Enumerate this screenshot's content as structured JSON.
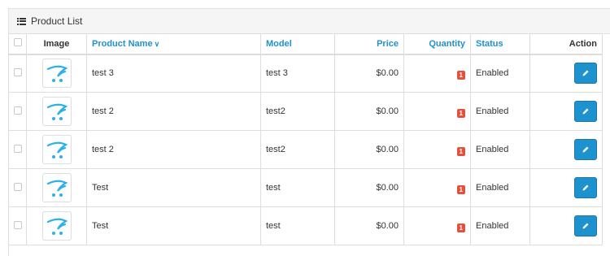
{
  "panel": {
    "title": "Product List"
  },
  "table": {
    "headers": {
      "image": "Image",
      "name": "Product Name",
      "model": "Model",
      "price": "Price",
      "quantity": "Quantity",
      "status": "Status",
      "action": "Action"
    },
    "sort_indicator": "∨",
    "rows": [
      {
        "name": "test 3",
        "model": "test 3",
        "price": "$0.00",
        "quantity": "1",
        "status": "Enabled"
      },
      {
        "name": "test 2",
        "model": "test2",
        "price": "$0.00",
        "quantity": "1",
        "status": "Enabled"
      },
      {
        "name": "test 2",
        "model": "test2",
        "price": "$0.00",
        "quantity": "1",
        "status": "Enabled"
      },
      {
        "name": "Test",
        "model": "test",
        "price": "$0.00",
        "quantity": "1",
        "status": "Enabled"
      },
      {
        "name": "Test",
        "model": "test",
        "price": "$0.00",
        "quantity": "1",
        "status": "Enabled"
      }
    ]
  },
  "colors": {
    "accent": "#1e91cf",
    "badge": "#e3503e",
    "heading_bg": "#f5f5f5"
  },
  "icons": {
    "panel": "list-icon",
    "thumbnail": "cart-logo-icon",
    "edit": "pencil-icon"
  }
}
